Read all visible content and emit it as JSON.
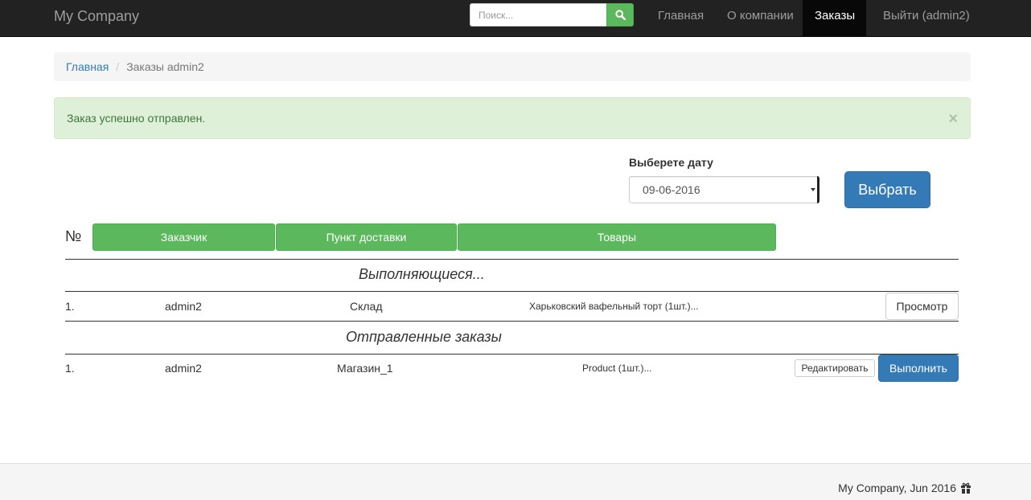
{
  "navbar": {
    "brand": "My Company",
    "search_placeholder": "Поиск...",
    "search_icon": "search-icon",
    "links": {
      "home": "Главная",
      "about": "О компании",
      "orders": "Заказы",
      "logout": "Выйти (admin2)"
    }
  },
  "breadcrumb": {
    "home": "Главная",
    "separator": "/",
    "current": "Заказы admin2"
  },
  "alert": {
    "message": "Заказ успешно отправлен.",
    "close": "×"
  },
  "date_form": {
    "label": "Выберете дату",
    "selected_date": "09-06-2016",
    "submit_label": "Выбрать"
  },
  "table": {
    "number_header": "№",
    "headers": {
      "customer": "Заказчик",
      "delivery_point": "Пункт доставки",
      "goods": "Товары"
    },
    "sections": {
      "in_progress": {
        "title": "Выполняющиеся...",
        "rows": [
          {
            "num": "1.",
            "customer": "admin2",
            "delivery_point": "Склад",
            "goods": "Харьковский вафельный торт (1шт.)...",
            "action": "Просмотр"
          }
        ]
      },
      "sent": {
        "title": "Отправленные заказы",
        "rows": [
          {
            "num": "1.",
            "customer": "admin2",
            "delivery_point": "Магазин_1",
            "goods": "Product (1шт.)...",
            "edit_action": "Редактировать",
            "execute_action": "Выполнить"
          }
        ]
      }
    }
  },
  "footer": {
    "text": "My Company, Jun 2016",
    "icon": "gift-icon"
  },
  "colors": {
    "navbar_bg": "#222222",
    "primary": "#337ab7",
    "success": "#5cb85c",
    "alert_bg": "#dff0d8",
    "alert_text": "#3c763d"
  }
}
